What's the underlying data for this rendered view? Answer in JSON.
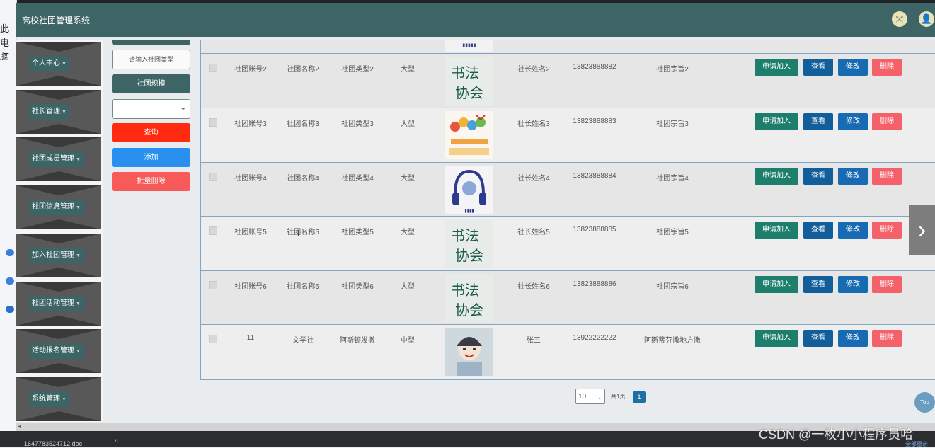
{
  "desktop": {
    "left_text_1": "此",
    "left_text_2": "电脑"
  },
  "header": {
    "title": "高校社团管理系统",
    "fullscreen_glyph": "⤧",
    "user_glyph": "👤"
  },
  "sidebar": {
    "items": [
      {
        "label": "个人中心"
      },
      {
        "label": "社长管理"
      },
      {
        "label": "社团成员管理"
      },
      {
        "label": "社团信息管理"
      },
      {
        "label": "加入社团管理"
      },
      {
        "label": "社团活动管理"
      },
      {
        "label": "活动报名管理"
      },
      {
        "label": "系统管理"
      }
    ],
    "caret": "▼"
  },
  "filter": {
    "type_placeholder": "请输入社团类型",
    "scale_label": "社团规模",
    "query_label": "查询",
    "add_label": "添加",
    "batch_delete_label": "批量删除",
    "chevron": "⌄"
  },
  "colors": {
    "header_bg": "#3e6565",
    "query_btn": "#ff2a0f",
    "add_btn": "#2a90f0",
    "batch_delete_btn": "#f85a5a",
    "join_btn": "#1c7e6b",
    "view_btn": "#125e9a",
    "edit_btn": "#186bb2",
    "delete_btn": "#f5616a"
  },
  "actions": {
    "join": "申请加入",
    "view": "查看",
    "edit": "修改",
    "delete": "删除"
  },
  "rows": [
    {
      "account": "社团账号2",
      "name": "社团名称2",
      "type": "社团类型2",
      "scale": "大型",
      "image": "calligraphy",
      "leader": "社长姓名2",
      "phone": "13823888882",
      "purpose": "社团宗旨2"
    },
    {
      "account": "社团账号3",
      "name": "社团名称3",
      "type": "社团类型3",
      "scale": "大型",
      "image": "hands",
      "leader": "社长姓名3",
      "phone": "13823888883",
      "purpose": "社团宗旨3"
    },
    {
      "account": "社团账号4",
      "name": "社团名称4",
      "type": "社团类型4",
      "scale": "大型",
      "image": "headphones",
      "leader": "社长姓名4",
      "phone": "13823888884",
      "purpose": "社团宗旨4"
    },
    {
      "account": "社团账号5",
      "name": "社团名称5",
      "type": "社团类型5",
      "scale": "大型",
      "image": "calligraphy",
      "leader": "社长姓名5",
      "phone": "13823888885",
      "purpose": "社团宗旨5"
    },
    {
      "account": "社团账号6",
      "name": "社团名称6",
      "type": "社团类型6",
      "scale": "大型",
      "image": "calligraphy",
      "leader": "社长姓名6",
      "phone": "13823888886",
      "purpose": "社团宗旨6"
    },
    {
      "account": "11",
      "name": "文学社",
      "type": "阿斯顿发撒",
      "scale": "中型",
      "image": "anime-girl",
      "leader": "张三",
      "phone": "13922222222",
      "purpose": "阿斯蒂芬撒地方撒"
    }
  ],
  "pager": {
    "page_size": "10",
    "label": "共1页",
    "current": "1",
    "chevron": "⌄"
  },
  "nav": {
    "next_glyph": "›",
    "top_label": "Top"
  },
  "taskbar": {
    "file_name": "1647783524712.doc",
    "up_glyph": "^",
    "show_all": "全部显示"
  },
  "watermark": "CSDN @一枚小小程序员哈"
}
